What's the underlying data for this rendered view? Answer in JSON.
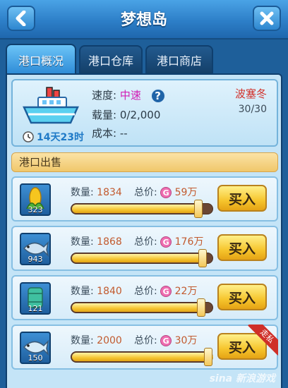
{
  "header": {
    "title": "梦想岛",
    "back_icon": "chevron-left-icon",
    "close_icon": "close-icon"
  },
  "tabs": [
    {
      "label": "港口概况",
      "active": true
    },
    {
      "label": "港口仓库",
      "active": false
    },
    {
      "label": "港口商店",
      "active": false
    }
  ],
  "ship": {
    "speed_label": "速度:",
    "speed_value": "中速",
    "load_label": "载量:",
    "load_value": "0/2,000",
    "cost_label": "成本:",
    "cost_value": "--",
    "timer": "14天23时",
    "captain": "波塞冬",
    "captain_count": "30/30"
  },
  "section": {
    "title": "港口出售"
  },
  "items": [
    {
      "icon": "corn-icon",
      "stock": "323",
      "qty_label": "数量:",
      "qty": "1834",
      "price_label": "总价:",
      "price": "59万",
      "buy_label": "买入",
      "fill": 0.9,
      "ribbon": ""
    },
    {
      "icon": "fish-icon",
      "stock": "943",
      "qty_label": "数量:",
      "qty": "1868",
      "price_label": "总价:",
      "price": "176万",
      "buy_label": "买入",
      "fill": 0.93,
      "ribbon": ""
    },
    {
      "icon": "barrel-icon",
      "stock": "121",
      "qty_label": "数量:",
      "qty": "1840",
      "price_label": "总价:",
      "price": "22万",
      "buy_label": "买入",
      "fill": 0.92,
      "ribbon": ""
    },
    {
      "icon": "fish-icon",
      "stock": "150",
      "qty_label": "数量:",
      "qty": "2000",
      "price_label": "总价:",
      "price": "30万",
      "buy_label": "买入",
      "fill": 1.0,
      "ribbon": "走私"
    }
  ],
  "coin_glyph": "G",
  "watermark": "sina 新浪游戏",
  "colors": {
    "accent": "#2d86cf",
    "buy": "#f6c52d",
    "speed": "#d21fb5",
    "captain": "#d2322b"
  }
}
